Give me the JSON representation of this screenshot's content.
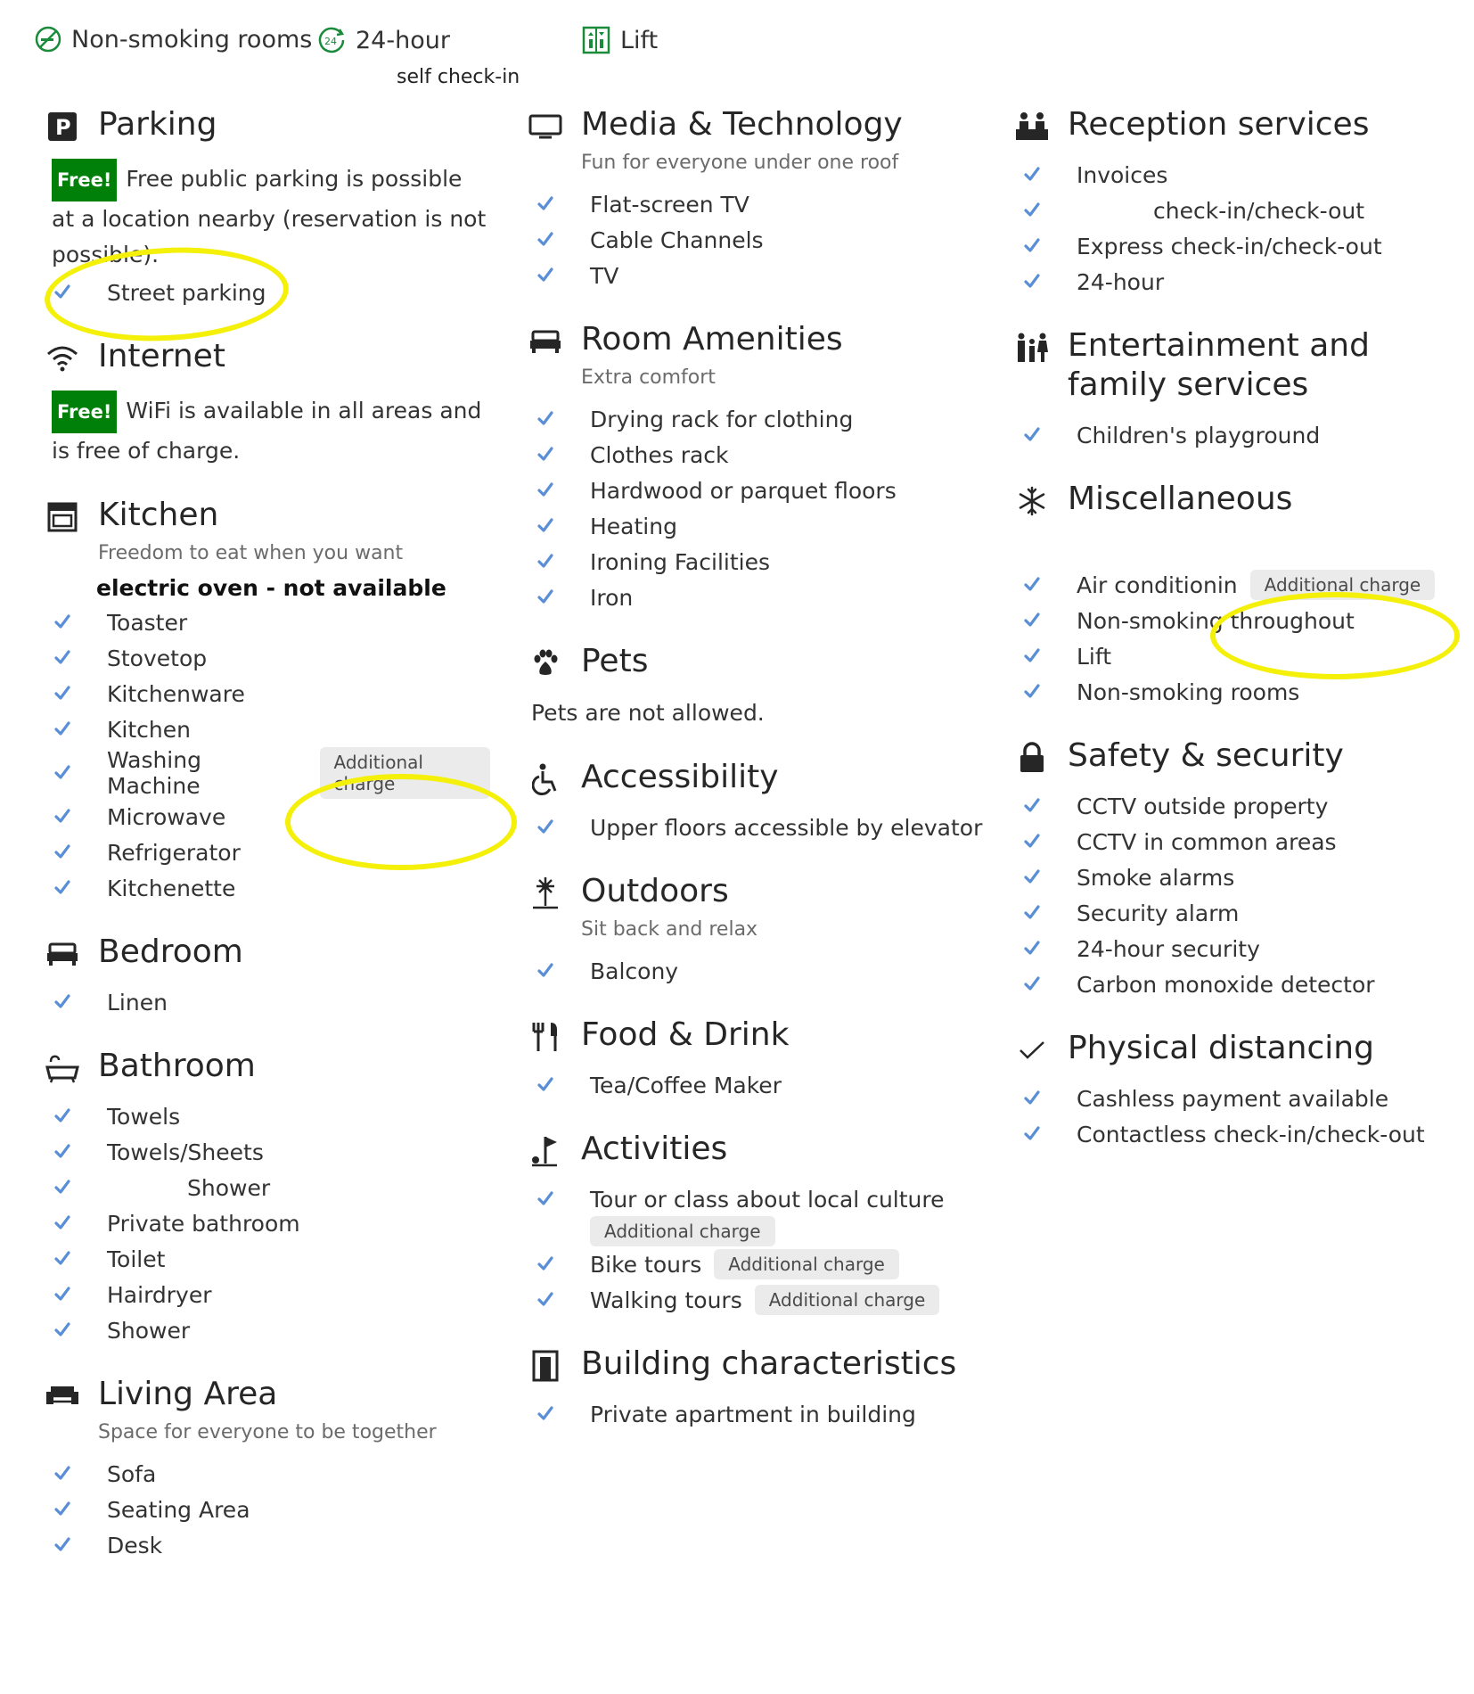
{
  "top": {
    "non_smoking": "Non-smoking rooms",
    "checkin_24": "24-hour",
    "checkin_24_sub": "self check-in",
    "lift": "Lift"
  },
  "parking": {
    "title": "Parking",
    "free": "Free!",
    "text": "Free public parking is possible at a location nearby (reservation is not possible).",
    "items": [
      "Street parking"
    ]
  },
  "internet": {
    "title": "Internet",
    "free": "Free!",
    "text": "WiFi is available in all areas and is free of charge."
  },
  "kitchen": {
    "title": "Kitchen",
    "subtitle": "Freedom to eat when you want",
    "note": "electric oven - not available",
    "items": [
      "Toaster",
      "Stovetop",
      "Kitchenware",
      "Kitchen",
      "Washing Machine",
      "Microwave",
      "Refrigerator",
      "Kitchenette"
    ],
    "washing_badge": "Additional charge"
  },
  "bedroom": {
    "title": "Bedroom",
    "items": [
      "Linen"
    ]
  },
  "bathroom": {
    "title": "Bathroom",
    "items": [
      "Towels",
      "Towels/Sheets",
      "Shower",
      "Private bathroom",
      "Toilet",
      "Hairdryer",
      "Shower"
    ]
  },
  "living": {
    "title": "Living Area",
    "subtitle": "Space for everyone to be together",
    "items": [
      "Sofa",
      "Seating Area",
      "Desk"
    ]
  },
  "media": {
    "title": "Media & Technology",
    "subtitle": "Fun for everyone under one roof",
    "items": [
      "Flat-screen TV",
      "Cable Channels",
      "TV"
    ]
  },
  "room": {
    "title": "Room Amenities",
    "subtitle": "Extra comfort",
    "items": [
      "Drying rack for clothing",
      "Clothes rack",
      "Hardwood or parquet floors",
      "Heating",
      "Ironing Facilities",
      "Iron"
    ]
  },
  "pets": {
    "title": "Pets",
    "text": "Pets are not allowed."
  },
  "access": {
    "title": "Accessibility",
    "items": [
      "Upper floors accessible by elevator"
    ]
  },
  "outdoors": {
    "title": "Outdoors",
    "subtitle": "Sit back and relax",
    "items": [
      "Balcony"
    ]
  },
  "food": {
    "title": "Food & Drink",
    "items": [
      "Tea/Coffee Maker"
    ]
  },
  "activities": {
    "title": "Activities",
    "items": [
      "Tour or class about local culture",
      "Bike tours",
      "Walking tours"
    ],
    "badge": "Additional charge"
  },
  "building": {
    "title": "Building characteristics",
    "items": [
      "Private apartment in building"
    ]
  },
  "reception": {
    "title": "Reception services",
    "items": [
      "Invoices",
      "check-in/check-out",
      "Express check-in/check-out",
      "24-hour"
    ]
  },
  "entertainment": {
    "title": "Entertainment and family services",
    "items": [
      "Children's playground"
    ]
  },
  "misc": {
    "title": "Miscellaneous",
    "items": [
      "Air conditionin",
      "Non-smoking throughout",
      "Lift",
      "Non-smoking rooms"
    ],
    "ac_badge": "Additional charge"
  },
  "safety": {
    "title": "Safety & security",
    "items": [
      "CCTV outside property",
      "CCTV in common areas",
      "Smoke alarms",
      "Security alarm",
      "24-hour security",
      "Carbon monoxide detector"
    ]
  },
  "distancing": {
    "title": "Physical distancing",
    "items": [
      "Cashless payment available",
      "Contactless check-in/check-out"
    ]
  },
  "colors": {
    "check": "#5a8ed6",
    "free": "#008009",
    "highlight": "#f4f00a",
    "badge_bg": "#ebebeb"
  }
}
